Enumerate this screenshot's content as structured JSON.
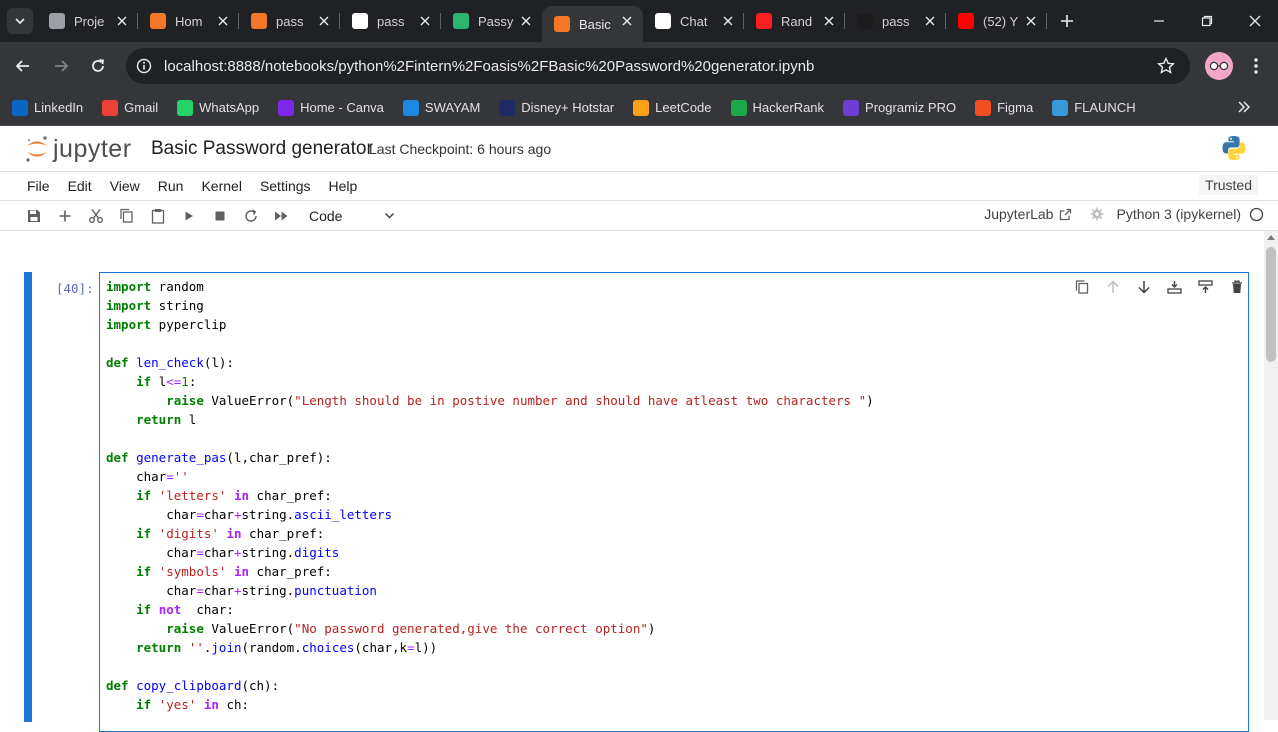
{
  "browser": {
    "tabs": [
      {
        "title": "Proje",
        "favicon": "globe-icon",
        "color": "#9aa0a6"
      },
      {
        "title": "Hom",
        "favicon": "coursera-icon",
        "color": "#f37726"
      },
      {
        "title": "pass",
        "favicon": "jupyter-book-icon",
        "color": "#f37726"
      },
      {
        "title": "pass",
        "favicon": "google-icon",
        "color": "#ffffff"
      },
      {
        "title": "Passy",
        "favicon": "map-pin-icon",
        "color": "#2bb673"
      },
      {
        "title": "Basic",
        "favicon": "jupyter-book-icon",
        "color": "#f37726",
        "active": true
      },
      {
        "title": "Chat",
        "favicon": "openai-icon",
        "color": "#ffffff"
      },
      {
        "title": "Rand",
        "favicon": "vercel-icon",
        "color": "#ff1f1f"
      },
      {
        "title": "pass",
        "favicon": "github-icon",
        "color": "#1c1c1c"
      },
      {
        "title": "(52) Y",
        "favicon": "youtube-icon",
        "color": "#ff0000"
      }
    ],
    "url": "localhost:8888/notebooks/python%2Fintern%2Foasis%2FBasic%20Password%20generator.ipynb",
    "bookmarks": [
      {
        "label": "LinkedIn",
        "icon": "linkedin-icon",
        "color": "#0a66c2"
      },
      {
        "label": "Gmail",
        "icon": "gmail-icon",
        "color": "#ea4335"
      },
      {
        "label": "WhatsApp",
        "icon": "whatsapp-icon",
        "color": "#25d366"
      },
      {
        "label": "Home - Canva",
        "icon": "canva-icon",
        "color": "#7d2ae8"
      },
      {
        "label": "SWAYAM",
        "icon": "swayam-icon",
        "color": "#1e88e5"
      },
      {
        "label": "Disney+ Hotstar",
        "icon": "hotstar-icon",
        "color": "#1f2a64"
      },
      {
        "label": "LeetCode",
        "icon": "leetcode-icon",
        "color": "#ffa116"
      },
      {
        "label": "HackerRank",
        "icon": "hackerrank-icon",
        "color": "#1ba94c"
      },
      {
        "label": "Programiz PRO",
        "icon": "programiz-icon",
        "color": "#6b3fd4"
      },
      {
        "label": "Figma",
        "icon": "figma-icon",
        "color": "#f24e1e"
      },
      {
        "label": "FLAUNCH",
        "icon": "flaunch-icon",
        "color": "#3a9ad9"
      }
    ]
  },
  "jupyter": {
    "logo_text": "jupyter",
    "notebook_title": "Basic Password generator",
    "checkpoint": "Last Checkpoint: 6 hours ago",
    "menu": [
      "File",
      "Edit",
      "View",
      "Run",
      "Kernel",
      "Settings",
      "Help"
    ],
    "trusted": "Trusted",
    "cell_type": "Code",
    "jupyterlab_label": "JupyterLab",
    "kernel": "Python 3 (ipykernel)",
    "accent": "#1976d2"
  },
  "cell": {
    "prompt": "[40]:",
    "code": [
      "import random",
      "import string",
      "import pyperclip",
      "",
      "def len_check(l):",
      "    if l<=1:",
      "        raise ValueError(\"Length should be in postive number and should have atleast two characters \")",
      "    return l",
      "",
      "def generate_pas(l,char_pref):",
      "    char=''",
      "    if 'letters' in char_pref:",
      "        char=char+string.ascii_letters",
      "    if 'digits' in char_pref:",
      "        char=char+string.digits",
      "    if 'symbols' in char_pref:",
      "        char=char+string.punctuation",
      "    if not  char:",
      "        raise ValueError(\"No password generated,give the correct option\")",
      "    return ''.join(random.choices(char,k=l))",
      "",
      "def copy_clipboard(ch):",
      "    if 'yes' in ch:"
    ]
  }
}
